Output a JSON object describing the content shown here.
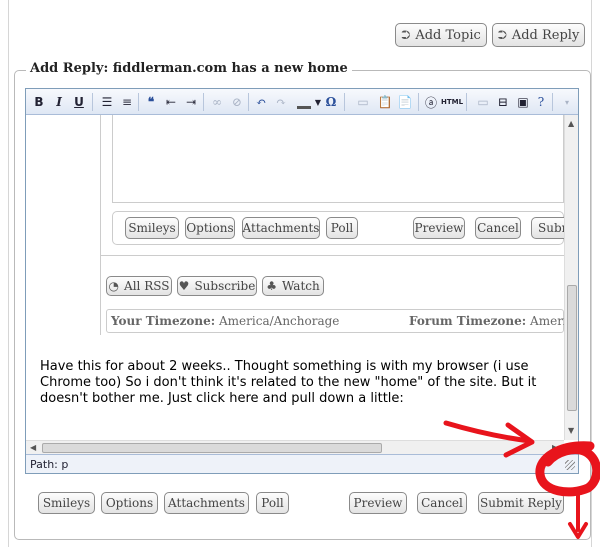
{
  "top_actions": {
    "add_topic": "Add Topic",
    "add_reply": "Add Reply"
  },
  "reply": {
    "legend": "Add Reply: fiddlerman.com has a new home",
    "toolbar": {
      "bold": "B",
      "italic": "I",
      "underline": "U",
      "omega": "Ω",
      "html": "HTML"
    },
    "quoted_page": {
      "buttons": [
        "Smileys",
        "Options",
        "Attachments",
        "Poll",
        "Preview",
        "Cancel",
        "Submit Reply"
      ],
      "rss": "All RSS",
      "subscribe": "Subscribe",
      "watch": "Watch",
      "your_tz_label": "Your Timezone:",
      "your_tz_value": "America/Anchorage",
      "forum_tz_label": "Forum Timezone:",
      "forum_tz_value": "America/Anchorage"
    },
    "message": "Have this for about 2 weeks.. Thought something is with my browser (i use Chrome too) So i don't think it's related to the new \"home\" of the site. But it doesn't bother me. Just click here and pull down a little:",
    "path": "Path: p",
    "buttons": {
      "smileys": "Smileys",
      "options": "Options",
      "attachments": "Attachments",
      "poll": "Poll",
      "preview": "Preview",
      "cancel": "Cancel",
      "submit": "Submit Reply"
    }
  },
  "colors": {
    "annotation": "#e8141c",
    "editor_border": "#7f9db9",
    "toolbar_bg": "#dfe7f4"
  }
}
